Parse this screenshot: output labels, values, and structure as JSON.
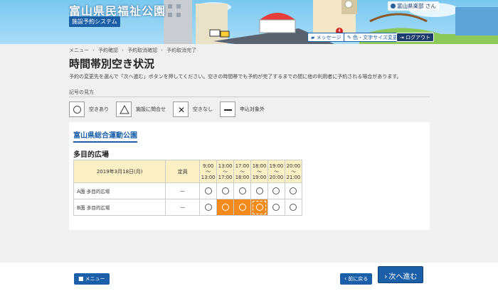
{
  "header": {
    "site_title": "富山県民福祉公園",
    "system_name": "施設予約システム",
    "user": "富山県楽部 さん",
    "message_label": "メッセージ",
    "message_count": "4",
    "text_size_label": "色・文字サイズ変更",
    "logout_label": "ログアウト"
  },
  "breadcrumb": [
    "メニュー",
    "予約確認",
    "予約取消確認",
    "予約取消完了"
  ],
  "page": {
    "title": "時間帯別空き状況",
    "description": "予約の変更先を選んで「次へ進む」ボタンを押してください。空きの時間帯でも予約が完了するまでの間に他の利用者に予約される場合があります。"
  },
  "legend": {
    "title": "記号の見方",
    "items": [
      {
        "symbol": "circle",
        "label": "空きあり"
      },
      {
        "symbol": "triangle",
        "label": "施設に問合せ"
      },
      {
        "symbol": "cross",
        "label": "空きなし",
        "glyph": "✕"
      },
      {
        "symbol": "dash",
        "label": "申込対象外"
      }
    ]
  },
  "facility": {
    "name": "富山県総合運動公園",
    "area": "多目的広場",
    "date_header": "2019年3月18日(月)",
    "capacity_header": "定員",
    "slots": [
      {
        "start": "9:00",
        "sep": "〜",
        "end": "13:00"
      },
      {
        "start": "13:00",
        "sep": "〜",
        "end": "17:00"
      },
      {
        "start": "17:00",
        "sep": "〜",
        "end": "18:00"
      },
      {
        "start": "18:00",
        "sep": "〜",
        "end": "19:00"
      },
      {
        "start": "19:00",
        "sep": "〜",
        "end": "20:00"
      },
      {
        "start": "20:00",
        "sep": "〜",
        "end": "21:00"
      }
    ],
    "rows": [
      {
        "face": "A面",
        "sub": "多目的広場",
        "capacity": "－",
        "states": [
          "available",
          "available",
          "available",
          "available",
          "available",
          "available"
        ]
      },
      {
        "face": "B面",
        "sub": "多目的広場",
        "capacity": "－",
        "states": [
          "available",
          "selected",
          "selected",
          "selected-dashed",
          "available",
          "available"
        ]
      }
    ]
  },
  "footer": {
    "menu_label": "メニュー",
    "back_label": "前に戻る",
    "next_label": "次へ進む"
  },
  "colors": {
    "primary": "#1a5fa8",
    "selected": "#f28a1c",
    "table_header": "#fbefc4"
  }
}
